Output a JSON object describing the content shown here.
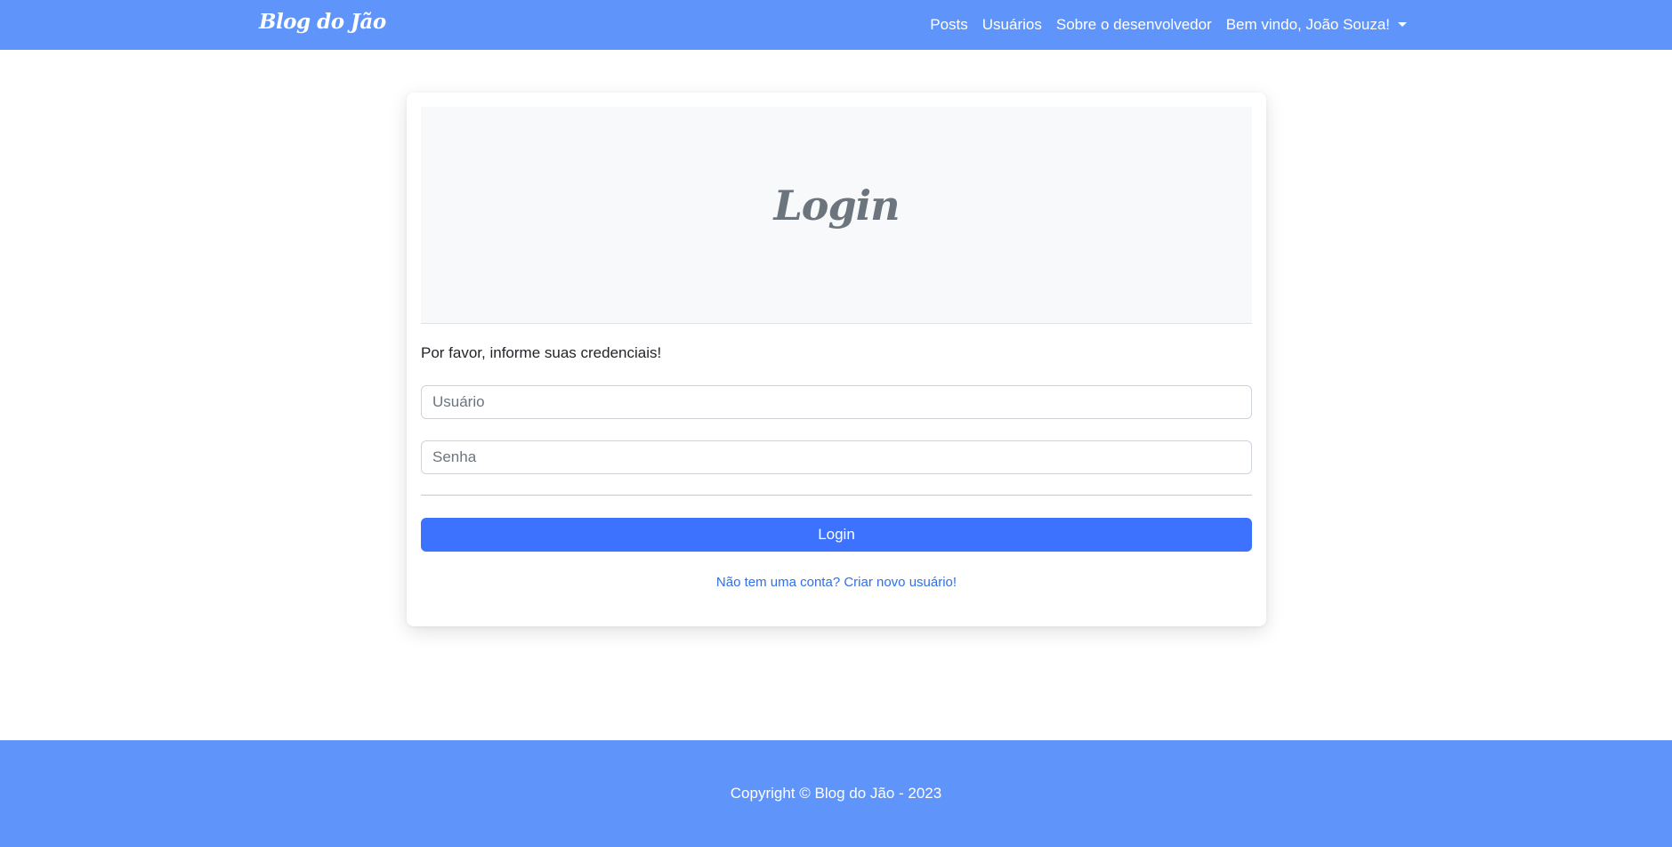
{
  "navbar": {
    "brand": "Blog do Jão",
    "links": [
      "Posts",
      "Usuários",
      "Sobre o desenvolvedor"
    ],
    "user_menu": "Bem vindo, João Souza!"
  },
  "login_card": {
    "title": "Login",
    "intro": "Por favor, informe suas credenciais!",
    "username_placeholder": "Usuário",
    "username_value": "",
    "password_placeholder": "Senha",
    "password_value": "",
    "submit_label": "Login",
    "signup_link": "Não tem uma conta? Criar novo usuário!"
  },
  "footer": {
    "copyright": "Copyright © Blog do Jão - 2023"
  },
  "colors": {
    "navbar_bg": "#5f95fb",
    "footer_bg": "#5f95fb",
    "primary_button": "#3d72fe",
    "link": "#2f6fe8",
    "card_header_bg": "#f8f9fa",
    "title_text": "#6c757d"
  }
}
